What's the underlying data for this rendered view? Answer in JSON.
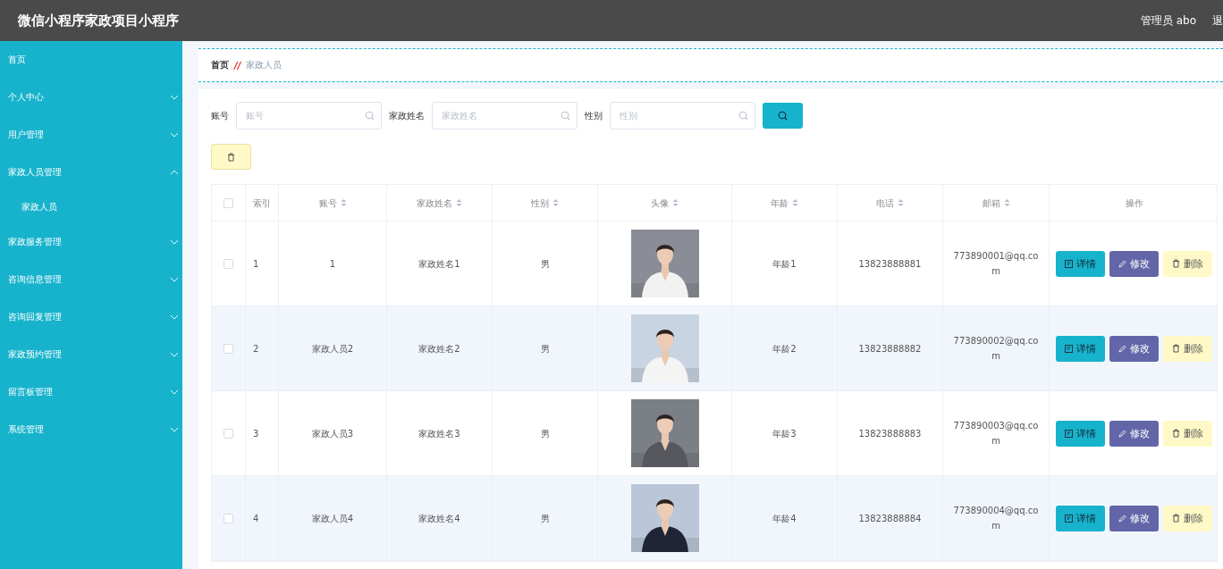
{
  "header": {
    "title": "微信小程序家政项目小程序",
    "user": "管理员 abo",
    "logout": "退"
  },
  "sidebar": {
    "items": [
      {
        "label": "首页"
      },
      {
        "label": "个人中心",
        "expanded": false
      },
      {
        "label": "用户管理",
        "expanded": false
      },
      {
        "label": "家政人员管理",
        "expanded": true,
        "children": [
          {
            "label": "家政人员"
          }
        ]
      },
      {
        "label": "家政服务管理",
        "expanded": false
      },
      {
        "label": "咨询信息管理",
        "expanded": false
      },
      {
        "label": "咨询回复管理",
        "expanded": false
      },
      {
        "label": "家政预约管理",
        "expanded": false
      },
      {
        "label": "留言板管理",
        "expanded": false
      },
      {
        "label": "系统管理",
        "expanded": false
      }
    ]
  },
  "breadcrumb": {
    "home": "首页",
    "separator": "//",
    "current": "家政人员"
  },
  "filters": [
    {
      "label": "账号",
      "placeholder": "账号"
    },
    {
      "label": "家政姓名",
      "placeholder": "家政姓名"
    },
    {
      "label": "性别",
      "placeholder": "性别"
    }
  ],
  "table": {
    "columns": [
      {
        "label": "索引",
        "sortable": false
      },
      {
        "label": "账号",
        "sortable": true
      },
      {
        "label": "家政姓名",
        "sortable": true
      },
      {
        "label": "性别",
        "sortable": true
      },
      {
        "label": "头像",
        "sortable": true
      },
      {
        "label": "年龄",
        "sortable": true
      },
      {
        "label": "电话",
        "sortable": true
      },
      {
        "label": "邮箱",
        "sortable": true
      },
      {
        "label": "操作",
        "sortable": false
      }
    ],
    "select_all": {
      "checked": false
    },
    "rows": [
      {
        "checked": false,
        "index": "1",
        "account": "1",
        "name": "家政姓名1",
        "gender": "男",
        "avatar": {
          "kind": "picture"
        },
        "age": "年龄1",
        "phone": "13823888881",
        "email": "773890001@qq.com",
        "actions": [
          "详情",
          "修改",
          "删除"
        ]
      },
      {
        "checked": false,
        "index": "2",
        "account": "家政人员2",
        "name": "家政姓名2",
        "gender": "男",
        "avatar": {
          "kind": "picture"
        },
        "age": "年龄2",
        "phone": "13823888882",
        "email": "773890002@qq.com",
        "actions": [
          "详情",
          "修改",
          "删除"
        ]
      },
      {
        "checked": false,
        "index": "3",
        "account": "家政人员3",
        "name": "家政姓名3",
        "gender": "男",
        "avatar": {
          "kind": "picture"
        },
        "age": "年龄3",
        "phone": "13823888883",
        "email": "773890003@qq.com",
        "actions": [
          "详情",
          "修改",
          "删除"
        ]
      },
      {
        "checked": false,
        "index": "4",
        "account": "家政人员4",
        "name": "家政姓名4",
        "gender": "男",
        "avatar": {
          "kind": "picture"
        },
        "age": "年龄4",
        "phone": "13823888884",
        "email": "773890004@qq.com",
        "actions": [
          "详情",
          "修改",
          "删除"
        ]
      }
    ]
  }
}
